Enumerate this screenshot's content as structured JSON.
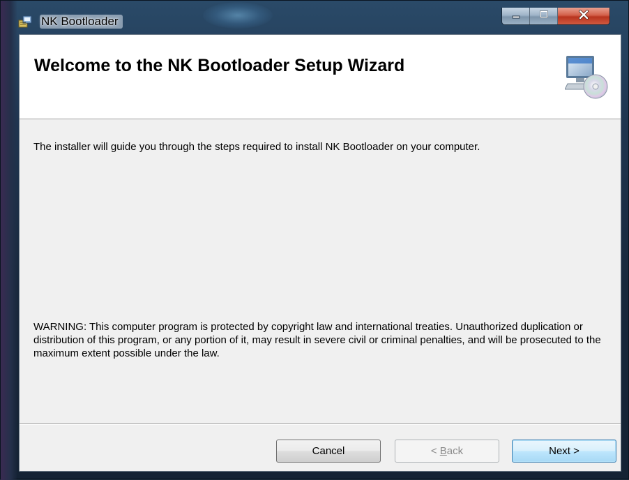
{
  "window": {
    "title": "NK Bootloader",
    "icons": {
      "app": "installer-icon",
      "minimize": "minimize-icon",
      "maximize": "maximize-icon",
      "close": "close-icon"
    }
  },
  "banner": {
    "title": "Welcome to the NK Bootloader Setup Wizard",
    "icon": "computer-cd-icon"
  },
  "body": {
    "intro": "The installer will guide you through the steps required to install NK Bootloader on your computer.",
    "warning": "WARNING: This computer program is protected by copyright law and international treaties. Unauthorized duplication or distribution of this program, or any portion of it, may result in severe civil or criminal penalties, and will be prosecuted to the maximum extent possible under the law."
  },
  "buttons": {
    "cancel": "Cancel",
    "back_prefix": "< ",
    "back_accel": "B",
    "back_rest": "ack",
    "next": "Next >",
    "back_enabled": false
  },
  "colors": {
    "frame": "#1f3550",
    "dialog_bg": "#f0f0f0",
    "banner_bg": "#ffffff",
    "close_button": "#c8452e",
    "default_button_border": "#3c7fb1"
  }
}
